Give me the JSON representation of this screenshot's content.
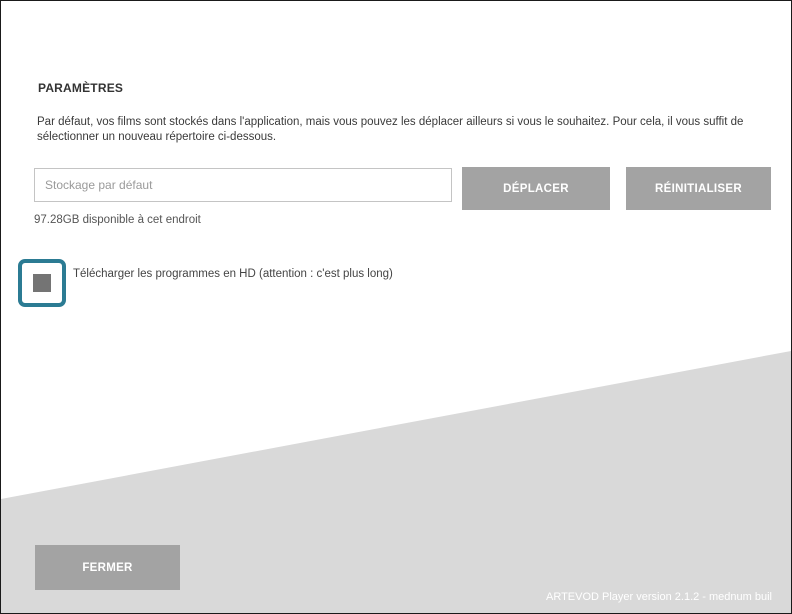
{
  "settings": {
    "title": "PARAMÈTRES",
    "description": "Par défaut, vos films sont stockés dans l'application, mais vous pouvez les déplacer ailleurs si vous le souhaitez. Pour cela, il vous suffit de sélectionner un nouveau répertoire ci-dessous.",
    "storage": {
      "placeholder": "Stockage par défaut",
      "value": "",
      "available_space": "97.28GB disponible à cet endroit"
    },
    "buttons": {
      "move_label": "DÉPLACER",
      "reset_label": "RÉINITIALISER"
    },
    "hd_option": {
      "label": "Télécharger les programmes en HD (attention : c'est plus long)",
      "checked": false
    }
  },
  "footer": {
    "close_label": "FERMER",
    "version_text": "ARTEVOD Player version 2.1.2 - mednum buil"
  },
  "colors": {
    "button_gray": "#a3a3a3",
    "background_shape": "#d9d9d9",
    "highlight": "#2b7b93"
  }
}
